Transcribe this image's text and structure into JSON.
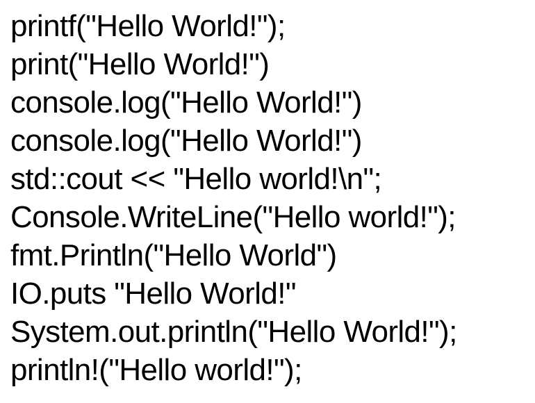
{
  "lines": [
    "printf(\"Hello World!\");",
    "print(\"Hello World!\")",
    "console.log(\"Hello World!\")",
    "console.log(\"Hello World!\")",
    "std::cout << \"Hello world!\\n\";",
    "Console.WriteLine(\"Hello world!\");",
    "fmt.Println(\"Hello World\")",
    "IO.puts \"Hello World!\"",
    "System.out.println(\"Hello World!\");",
    "println!(\"Hello world!\");"
  ],
  "colors": {
    "background": "#ffffff",
    "text": "#000000"
  }
}
